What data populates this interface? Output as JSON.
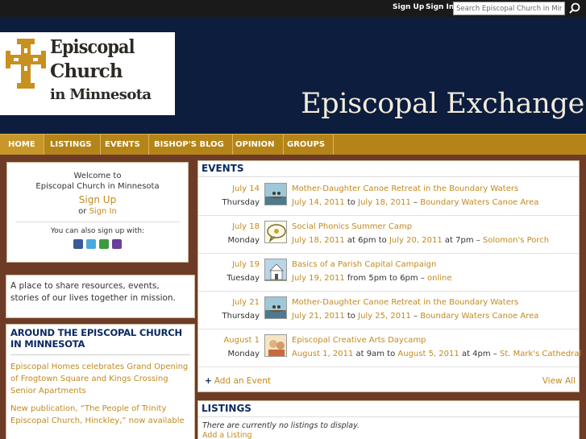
{
  "topbar": {
    "sign_up": "Sign Up",
    "sign_in": "Sign In",
    "search_placeholder": "Search Episcopal Church in Minn"
  },
  "header": {
    "logo_lines": [
      "Episcopal",
      "Church",
      "in Minnesota"
    ],
    "site_title": "Episcopal Exchange"
  },
  "nav": [
    "HOME",
    "LISTINGS",
    "EVENTS",
    "BISHOP'S BLOG",
    "OPINION",
    "GROUPS"
  ],
  "welcome": {
    "line1": "Welcome to",
    "line2": "Episcopal Church in Minnesota",
    "sign_up": "Sign Up",
    "or": "or",
    "sign_in": "Sign In",
    "also": "You can also sign up with:"
  },
  "about": "A place to share resources, events, stories of our lives together in mission.",
  "around": {
    "title": "AROUND THE EPISCOPAL CHURCH IN MINNESOTA",
    "items": [
      "Episcopal Homes celebrates Grand Opening of Frogtown Square and Kings Crossing Senior Apartments",
      "New publication, “The People of Trinity Episcopal Church, Hinckley,” now available"
    ]
  },
  "events": {
    "title": "EVENTS",
    "items": [
      {
        "date": "July 14",
        "dow": "Thursday",
        "title": "Mother-Daughter Canoe Retreat in the Boundary Waters",
        "start": "July 14, 2011",
        "sep1": "to",
        "end": "July 18, 2011",
        "dash": "–",
        "loc": "Boundary Waters Canoe Area"
      },
      {
        "date": "July 18",
        "dow": "Monday",
        "title": "Social Phonics Summer Camp",
        "start": "July 18, 2011",
        "sep1": "at 6pm to",
        "end": "July 20, 2011",
        "dash": "at 7pm –",
        "loc": "Solomon's Porch"
      },
      {
        "date": "July 19",
        "dow": "Tuesday",
        "title": "Basics of a Parish Capital Campaign",
        "start": "July 19, 2011",
        "sep1": "from 5pm to 6pm –",
        "end": "",
        "dash": "",
        "loc": "online"
      },
      {
        "date": "July 21",
        "dow": "Thursday",
        "title": "Mother-Daughter Canoe Retreat in the Boundary Waters",
        "start": "July 21, 2011",
        "sep1": "to",
        "end": "July 25, 2011",
        "dash": "–",
        "loc": "Boundary Waters Canoe Area"
      },
      {
        "date": "August 1",
        "dow": "Monday",
        "title": "Episcopal Creative Arts Daycamp",
        "start": "August 1, 2011",
        "sep1": "at 9am to",
        "end": "August 5, 2011",
        "dash": "at 4pm –",
        "loc": "St. Mark's Cathedral"
      }
    ],
    "add": "Add an Event",
    "view_all": "View All"
  },
  "listings": {
    "title": "LISTINGS",
    "none": "There are currently no listings to display.",
    "add": "Add a Listing"
  },
  "colors": {
    "nav_bg": "#b58418",
    "header_bg": "#0c1d3e",
    "page_bg": "#6e3c26",
    "link": "#c28a1e",
    "heading": "#0c2a62"
  }
}
